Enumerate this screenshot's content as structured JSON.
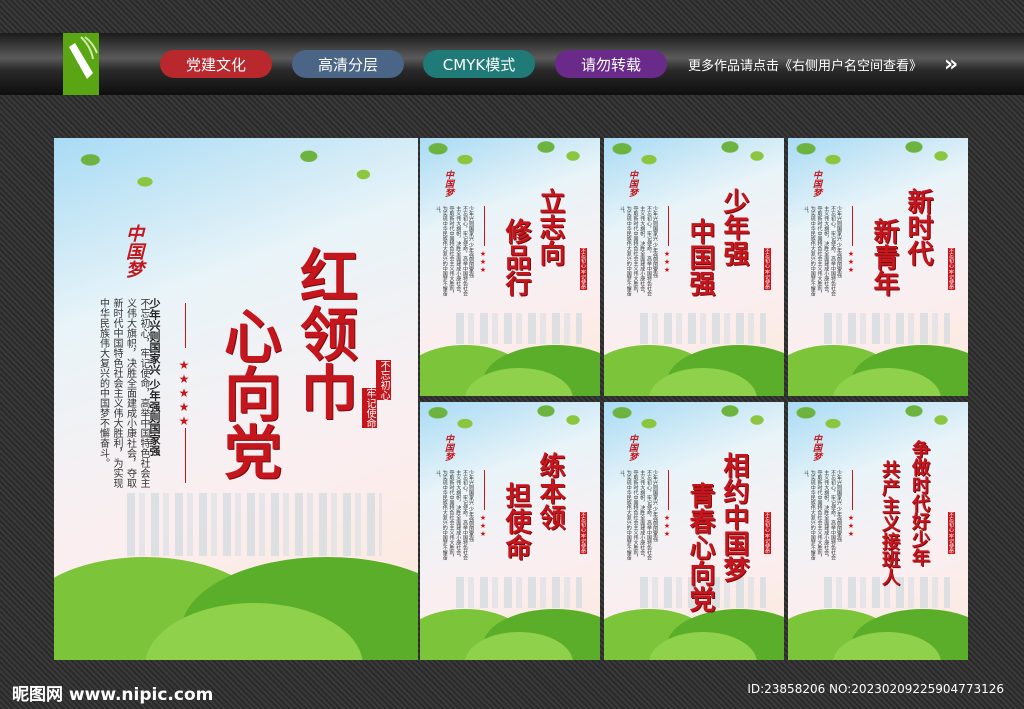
{
  "toolbar": {
    "tags": [
      {
        "label": "党建文化",
        "color": "#b8282c"
      },
      {
        "label": "高清分层",
        "color": "#4a6585"
      },
      {
        "label": "CMYK模式",
        "color": "#1f7a78"
      },
      {
        "label": "请勿转载",
        "color": "#6a2a8a"
      }
    ],
    "more_text": "更多作品请点击《右侧用户名空间查看》",
    "arrow": "»"
  },
  "main_poster": {
    "logo": "中国梦",
    "title_right": "红领巾",
    "title_left": "心向党",
    "subtitle": "少年兴则国家兴 少年强则国家强",
    "body": "不忘初心，牢记使命，高举中国特色社会主义伟大旗帜，决胜全面建成小康社会，夺取新时代中国特色社会主义伟大胜利，为实现中华民族伟大复兴的中国梦不懈奋斗。",
    "slogan_a": "不忘初心",
    "slogan_b": "牢记使命",
    "stars": "★★★★★"
  },
  "panels": [
    {
      "right": "立志向",
      "left": "修品行"
    },
    {
      "right": "少年强",
      "left": "中国强"
    },
    {
      "right": "新时代",
      "left": "新青年"
    },
    {
      "right": "练本领",
      "left": "担使命"
    },
    {
      "right": "相约中国梦",
      "left": "青春心向党"
    },
    {
      "right": "争做时代好少年",
      "left": "共产主义接班人"
    }
  ],
  "panel_common": {
    "logo": "中国梦",
    "subtitle": "少年兴则国家兴 少年强则国家强",
    "body": "不忘初心，牢记使命，高举中国特色社会主义伟大旗帜，决胜全面建成小康社会，夺取新时代中国特色社会主义伟大胜利，为实现中华民族伟大复兴的中国梦不懈奋斗。",
    "slogan": "不忘初心 牢记使命"
  },
  "footer": {
    "watermark": "昵图网 www.nipic.com",
    "id": "ID:23858206 NO:20230209225904773126"
  }
}
